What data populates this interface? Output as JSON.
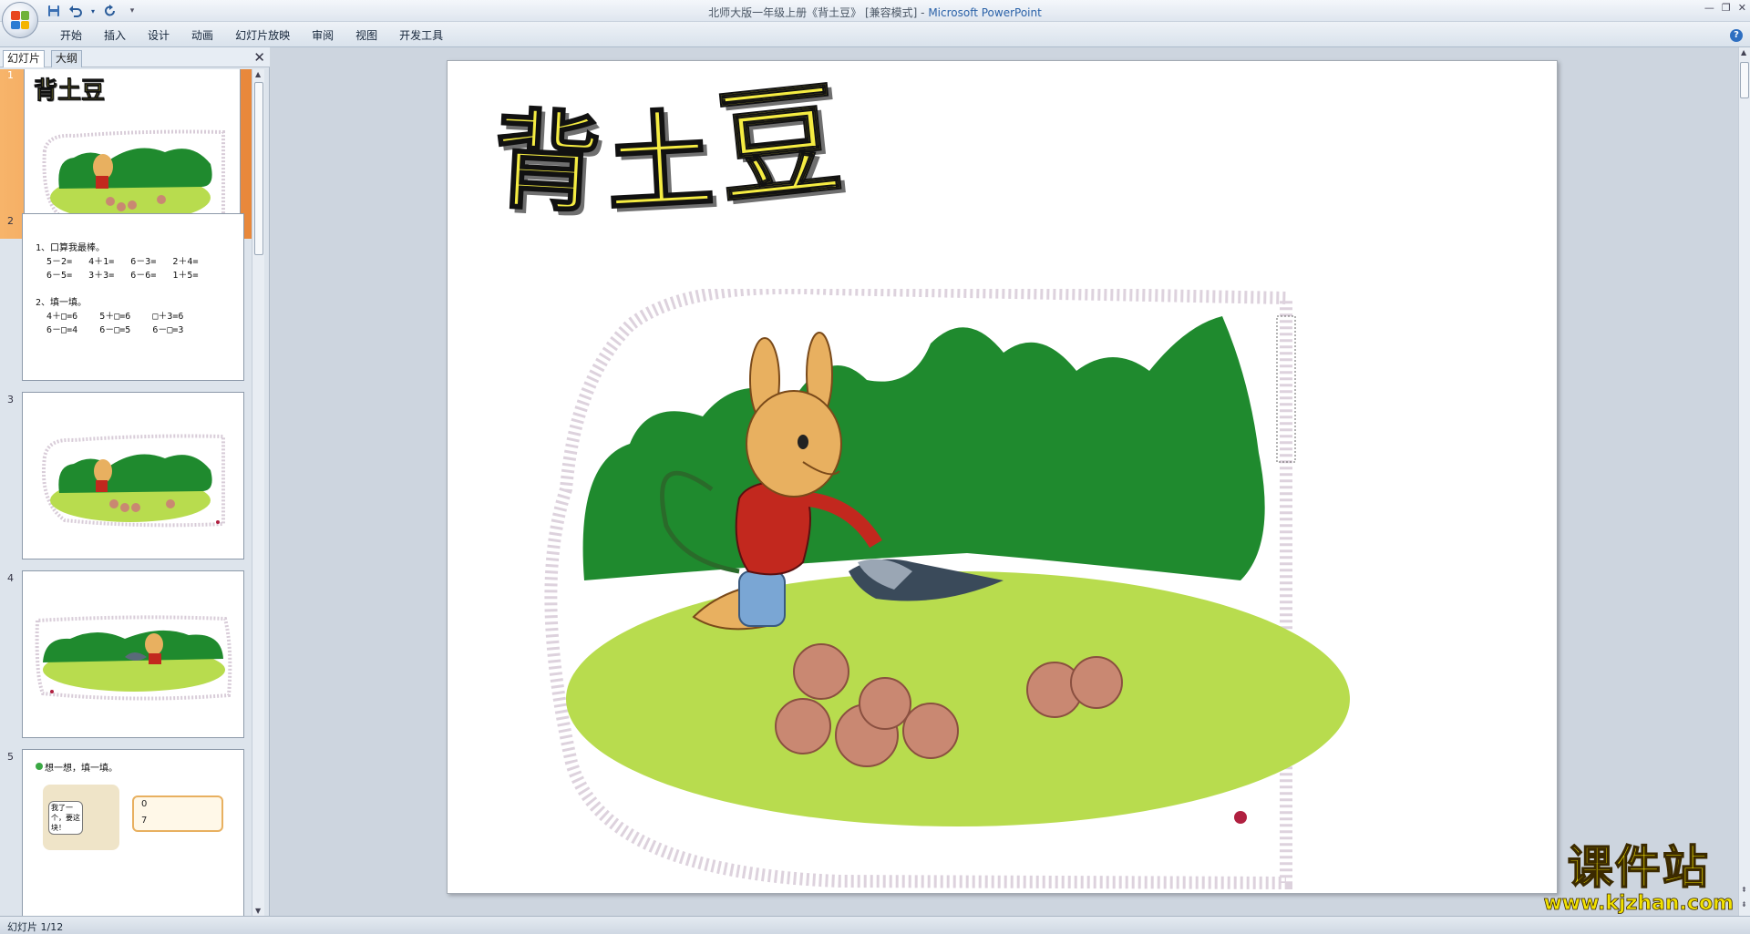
{
  "window": {
    "title": "北师大版一年级上册《背土豆》 [兼容模式]",
    "separator": " - ",
    "app": "Microsoft PowerPoint",
    "controls": [
      "—",
      "❐",
      "✕"
    ]
  },
  "quick_access": [
    "save-icon",
    "undo-icon",
    "redo-icon",
    "customize-icon"
  ],
  "ribbon": {
    "tabs": [
      "开始",
      "插入",
      "设计",
      "动画",
      "幻灯片放映",
      "审阅",
      "视图",
      "开发工具"
    ],
    "help": "?"
  },
  "left_pane": {
    "tabs": [
      "幻灯片",
      "大纲"
    ],
    "close": "✕",
    "slides": [
      {
        "number": "1",
        "title": "背土豆",
        "selected": true
      },
      {
        "number": "2",
        "text": "1、口算我最棒。\n  5－2=   4＋1=   6－3=   2＋4=\n  6－5=   3＋3=   6－6=   1＋5=\n\n2、填一填。\n  4＋□=6    5＋□=6    □＋3=6\n  6－□=4    6－□=5    6－□=3"
      },
      {
        "number": "3"
      },
      {
        "number": "4"
      },
      {
        "number": "5",
        "caption": "想一想，填一填。",
        "bubble": "我了一个，要这块！",
        "grid_values": [
          "0",
          "7"
        ]
      }
    ]
  },
  "slide": {
    "title_chars": [
      "背",
      "土",
      "豆"
    ]
  },
  "status": {
    "text": "幻灯片 1/12"
  },
  "watermark": {
    "brand": "课件站",
    "url": "www.kjzhan.com"
  },
  "colors": {
    "title_fill": "#f5ec42",
    "selected_thumb": "#f0a050",
    "bush": "#1f8a2e",
    "grass": "#b8dc4e",
    "potato": "#c98872"
  }
}
